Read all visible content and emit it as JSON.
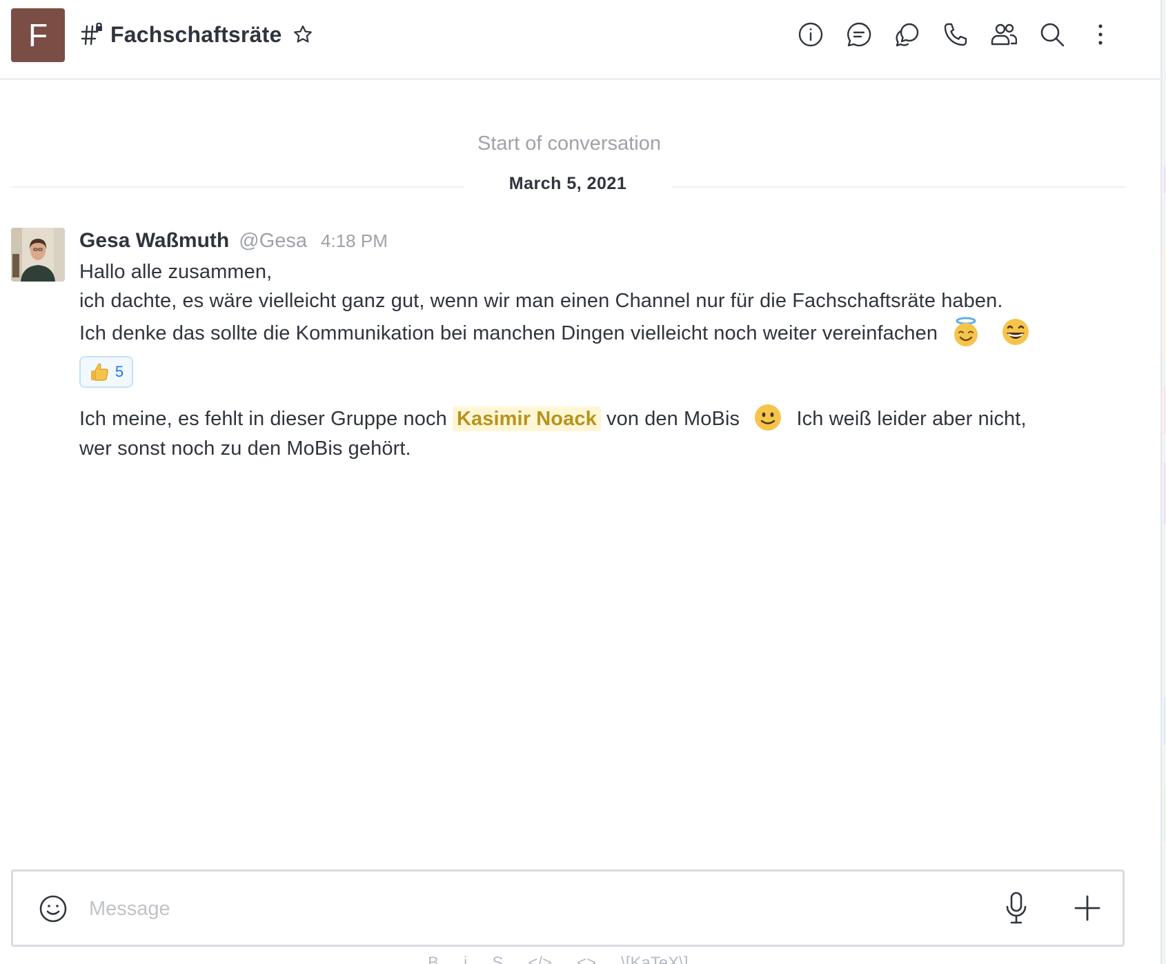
{
  "header": {
    "avatar_letter": "F",
    "room_name": "Fachschaftsräte",
    "room_type_icon": "private-channel-icon",
    "toolbar": [
      {
        "name": "room-info-icon"
      },
      {
        "name": "discussion-icon"
      },
      {
        "name": "threads-icon"
      },
      {
        "name": "call-icon"
      },
      {
        "name": "members-icon"
      },
      {
        "name": "search-icon"
      },
      {
        "name": "kebab-menu-icon"
      }
    ]
  },
  "conversation": {
    "start_label": "Start of conversation",
    "date": "March 5, 2021"
  },
  "message": {
    "author": "Gesa Waßmuth",
    "username": "@Gesa",
    "time": "4:18 PM",
    "line1": "Hallo alle zusammen,",
    "line2": "ich dachte, es wäre vielleicht ganz gut, wenn wir man einen Channel nur für die Fachschaftsräte haben.",
    "line3": "Ich denke das sollte die Kommunikation bei manchen Dingen vielleicht noch weiter vereinfachen",
    "line3_emojis": [
      "innocent-emoji",
      "grin-emoji"
    ],
    "reaction": {
      "emoji": "thumbs-up-emoji",
      "count": "5"
    }
  },
  "message2": {
    "part1": "Ich meine, es fehlt in dieser Gruppe noch",
    "mention": "Kasimir Noack",
    "part2": "von den MoBis",
    "emoji": "slight-smile-emoji",
    "part3": "Ich weiß leider aber nicht,",
    "line2": "wer sonst noch zu den MoBis gehört."
  },
  "composer": {
    "placeholder": "Message",
    "value": ""
  },
  "format_bar": [
    "B",
    "i",
    "S",
    "</>",
    "<>",
    "\\[KaTeX\\]"
  ],
  "colors": {
    "room_avatar": "#7b4e45",
    "mention_text": "#b8931c",
    "mention_bg": "#fff6d6",
    "reaction_border": "#c6e1f8",
    "reaction_count": "#1d74f5"
  }
}
